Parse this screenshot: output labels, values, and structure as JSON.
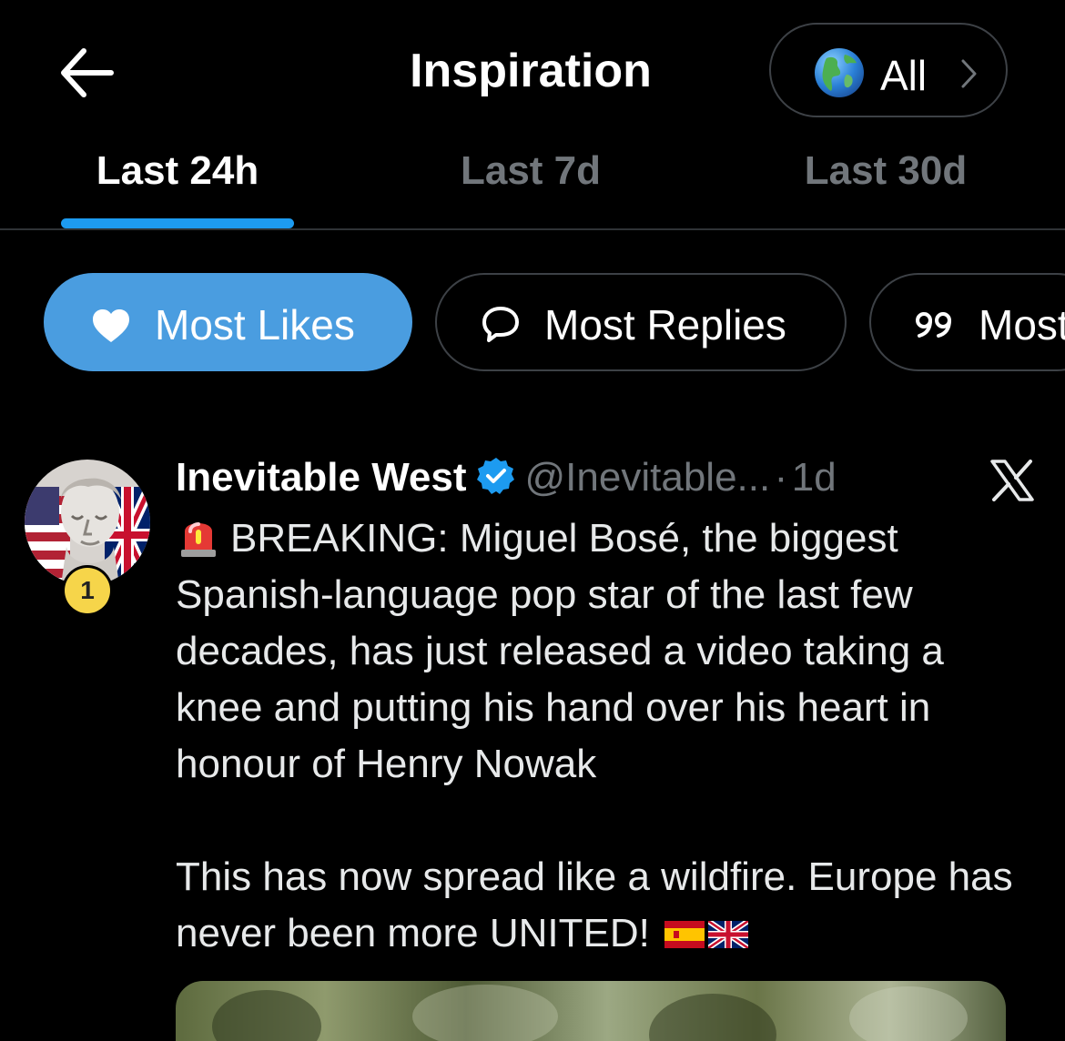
{
  "header": {
    "title": "Inspiration",
    "region_label": "All"
  },
  "tabs": [
    {
      "label": "Last 24h",
      "active": true
    },
    {
      "label": "Last 7d",
      "active": false
    },
    {
      "label": "Last 30d",
      "active": false
    }
  ],
  "filters": [
    {
      "label": "Most Likes",
      "icon": "heart-icon",
      "active": true
    },
    {
      "label": "Most Replies",
      "icon": "reply-bubble-icon",
      "active": false
    },
    {
      "label": "Most",
      "icon": "quote-icon",
      "active": false
    }
  ],
  "post": {
    "rank": "1",
    "display_name": "Inevitable West",
    "handle": "@Inevitable...",
    "separator": "·",
    "time": "1d",
    "body_paragraph_1": "BREAKING: Miguel Bosé, the biggest Spanish-language pop star of the last few decades, has just released a video taking a knee and putting his hand over his heart in honour of Henry Nowak",
    "body_paragraph_2": "This has now spread like a wildfire. Europe has never been more UNITED!",
    "icons": [
      "verified-badge-icon",
      "x-logo-icon",
      "siren-emoji-icon",
      "spain-flag-icon",
      "uk-flag-icon"
    ]
  },
  "colors": {
    "background": "#000000",
    "accent": "#1d9bf0",
    "active_chip": "#4a9de0",
    "muted_text": "#71767b",
    "badge": "#f6d54a"
  }
}
